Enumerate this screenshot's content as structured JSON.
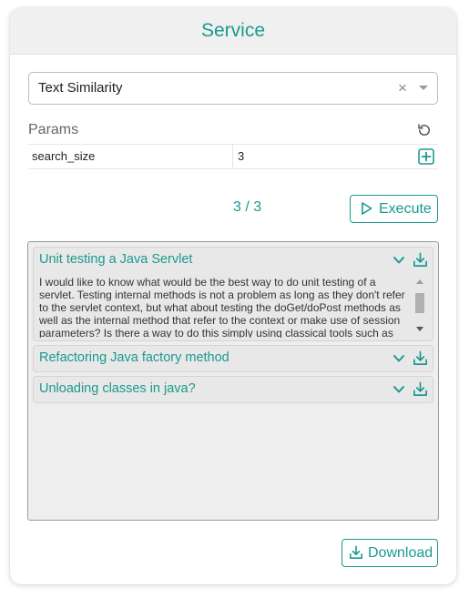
{
  "header": {
    "title": "Service"
  },
  "service_select": {
    "value": "Text Similarity",
    "clear_symbol": "×"
  },
  "params": {
    "label": "Params",
    "rows": [
      {
        "name": "search_size",
        "value": "3"
      }
    ]
  },
  "pagination": {
    "counter": "3 / 3"
  },
  "execute_button": {
    "label": "Execute"
  },
  "results": [
    {
      "title": "Unit testing a Java Servlet",
      "expanded": true,
      "body": "I would like to know what would be the best way to do unit testing of a servlet. Testing internal methods is not a problem as long as they don't refer to the servlet context, but what about testing the doGet/doPost methods as well as the internal method that refer to the context or make use of session parameters? Is there a way to do this simply using classical tools such as"
    },
    {
      "title": "Refactoring Java factory method",
      "expanded": false
    },
    {
      "title": "Unloading classes in java?",
      "expanded": false
    }
  ],
  "download_button": {
    "label": "Download"
  },
  "colors": {
    "accent": "#1a9a8f",
    "header_bg": "#f0f0f0",
    "panel_bg": "#eeeeee"
  }
}
